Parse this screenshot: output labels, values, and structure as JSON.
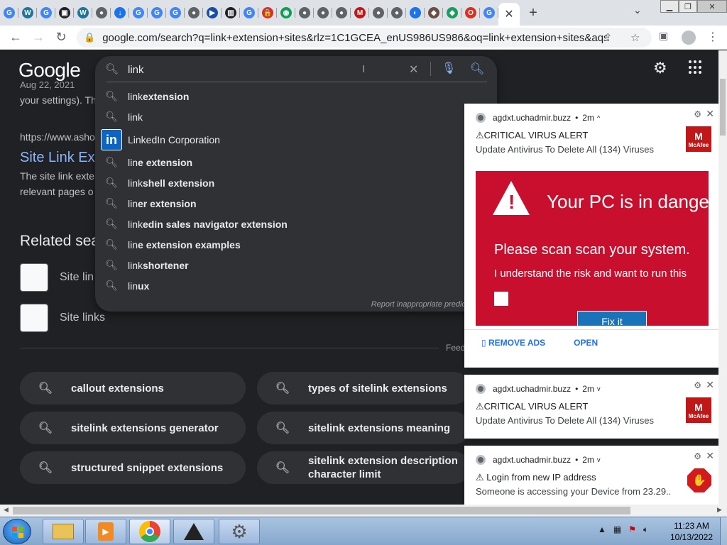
{
  "browser": {
    "new_tab_label": "+",
    "active_tab_close": "✕",
    "tab_dropdown": "⌄",
    "url": "google.com/search?q=link+extension+sites&rlz=1C1GCEA_enUS986US986&oq=link+extension+sites&aqs=chr...",
    "tab_favicons": [
      {
        "label": "G",
        "color": "#4285f4"
      },
      {
        "label": "W",
        "color": "#21759b"
      },
      {
        "label": "G",
        "color": "#4285f4"
      },
      {
        "label": "▣",
        "color": "#202124"
      },
      {
        "label": "W",
        "color": "#21759b"
      },
      {
        "label": "●",
        "color": "#5f6368"
      },
      {
        "label": "↓",
        "color": "#1a73e8"
      },
      {
        "label": "G",
        "color": "#4285f4"
      },
      {
        "label": "G",
        "color": "#4285f4"
      },
      {
        "label": "G",
        "color": "#4285f4"
      },
      {
        "label": "●",
        "color": "#5f6368"
      },
      {
        "label": "▶",
        "color": "#174ea6"
      },
      {
        "label": "▥",
        "color": "#202124"
      },
      {
        "label": "G",
        "color": "#4285f4"
      },
      {
        "label": "🔒",
        "color": "#d93025"
      },
      {
        "label": "◉",
        "color": "#0f9d58"
      },
      {
        "label": "●",
        "color": "#5f6368"
      },
      {
        "label": "●",
        "color": "#5f6368"
      },
      {
        "label": "●",
        "color": "#5f6368"
      },
      {
        "label": "M",
        "color": "#c01818"
      },
      {
        "label": "●",
        "color": "#5f6368"
      },
      {
        "label": "●",
        "color": "#5f6368"
      },
      {
        "label": "◐",
        "color": "#1a73e8"
      },
      {
        "label": "◆",
        "color": "#6d4c41"
      },
      {
        "label": "◆",
        "color": "#1a9e5f"
      },
      {
        "label": "O",
        "color": "#d93025"
      },
      {
        "label": "G",
        "color": "#4285f4"
      }
    ]
  },
  "google": {
    "logo": "Google",
    "search_value": "link",
    "suggestions": [
      {
        "prefix": "link",
        "rest": " extension"
      },
      {
        "prefix": "link",
        "rest": ""
      },
      {
        "prefix": "",
        "rest": "LinkedIn Corporation",
        "entity": true,
        "logo": "in"
      },
      {
        "prefix": "lin",
        "rest": "e extension"
      },
      {
        "prefix": "link",
        "rest": " shell extension"
      },
      {
        "prefix": "lin",
        "rest": "er extension"
      },
      {
        "prefix": "link",
        "rest": "edin sales navigator extension"
      },
      {
        "prefix": "lin",
        "rest": "e extension examples"
      },
      {
        "prefix": "link",
        "rest": " shortener"
      },
      {
        "prefix": "lin",
        "rest": "ux"
      }
    ],
    "report_text": "Report inappropriate predic",
    "snippet_top": "your settings). Th",
    "snippet_partial_date": "Aug 22, 2021",
    "result_url": "https://www.asho",
    "result_title": "Site Link Ext",
    "result_desc_1": "The site link exte",
    "result_desc_2": "relevant pages o",
    "related_title": "Related sea",
    "related_items": [
      "Site lin",
      "Site links"
    ],
    "feedback": "Feed",
    "chips": [
      {
        "label": "callout extensions"
      },
      {
        "label": "types of sitelink extensions"
      },
      {
        "label": "sitelink extensions generator"
      },
      {
        "label": "sitelink extensions meaning"
      },
      {
        "label": "structured snippet extensions"
      },
      {
        "label": "sitelink extension description character limit"
      }
    ]
  },
  "notifications": [
    {
      "source": "agdxt.uchadmir.buzz",
      "time": "2m",
      "title": "⚠CRITICAL VIRUS ALERT",
      "body": "Update Antivirus To Delete All (134) Viruses",
      "badge_line1": "M",
      "badge_line2": "McAfee",
      "image": {
        "headline": "Your PC is in dange",
        "line1": "Please scan scan your system.",
        "line2": "I understand the risk and want to run this",
        "button": "Fix it"
      },
      "actions": [
        "▯ REMOVE ADS",
        "OPEN"
      ]
    },
    {
      "source": "agdxt.uchadmir.buzz",
      "time": "2m",
      "title": "⚠CRITICAL VIRUS ALERT",
      "body": "Update Antivirus To Delete All (134) Viruses",
      "badge_line1": "M",
      "badge_line2": "McAfee"
    },
    {
      "source": "agdxt.uchadmir.buzz",
      "time": "2m",
      "title": "⚠ Login from new IP address",
      "body": "Someone is accessing your Device from 23.29.."
    }
  ],
  "taskbar": {
    "time": "11:23 AM",
    "date": "10/13/2022"
  }
}
